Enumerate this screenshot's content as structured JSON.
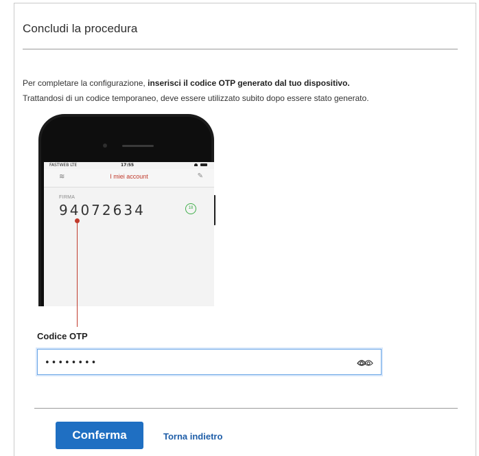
{
  "header": {
    "title": "Concludi la procedura"
  },
  "instructions": {
    "line1_before": "Per completare la configurazione, ",
    "line1_bold": "inserisci il codice OTP generato dal tuo dispositivo.",
    "line2": "Trattandosi di un codice temporaneo, deve essere utilizzato subito dopo essere stato generato."
  },
  "illustration": {
    "carrier": "FASTWEB LTE",
    "time": "17:55",
    "app_title": "I miei account",
    "label": "FIRMA",
    "otp_code": "94072634",
    "timer": "18",
    "accent_color": "#c0392b",
    "timer_color": "#3fae49"
  },
  "form": {
    "label": "Codice OTP",
    "value": "••••••••",
    "toggle_icon": "eye-icon"
  },
  "actions": {
    "confirm_label": "Conferma",
    "back_label": "Torna indietro",
    "primary_color": "#1f6fc2"
  }
}
